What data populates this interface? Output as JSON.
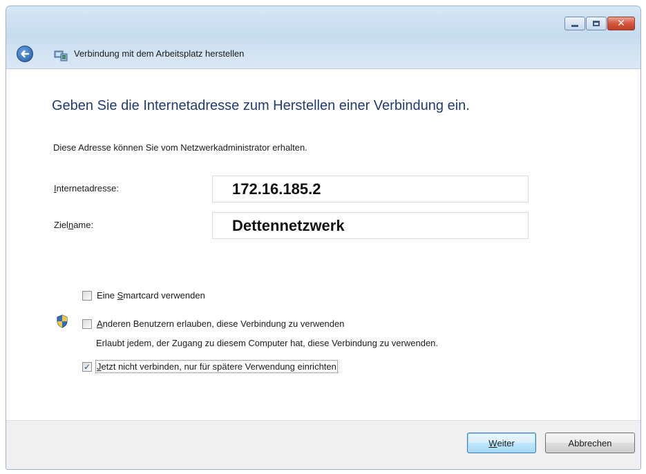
{
  "window": {
    "title": "Verbindung mit dem Arbeitsplatz herstellen",
    "caption_buttons": {
      "minimize": "minimize-icon",
      "maximize": "maximize-icon",
      "close": "close-icon"
    }
  },
  "main": {
    "heading": "Geben Sie die Internetadresse zum Herstellen einer Verbindung ein.",
    "description": "Diese Adresse können Sie vom Netzwerkadministrator erhalten.",
    "fields": [
      {
        "label_prefix": "",
        "label_accel": "I",
        "label_rest": "nternetadresse:",
        "value": "172.16.185.2"
      },
      {
        "label_prefix": "Ziel",
        "label_accel": "n",
        "label_rest": "ame:",
        "value": "Dettennetzwerk"
      }
    ],
    "options": {
      "smartcard": {
        "prefix": "Eine ",
        "accel": "S",
        "rest": "martcard verwenden",
        "checked": false
      },
      "allow_others": {
        "prefix": "",
        "accel": "A",
        "rest": "nderen Benutzern erlauben, diese Verbindung zu verwenden",
        "checked": false,
        "sublabel": "Erlaubt jedem, der Zugang zu diesem Computer hat, diese Verbindung zu verwenden."
      },
      "connect_later": {
        "prefix": "",
        "accel": "J",
        "rest": "etzt nicht verbinden, nur für spätere Verwendung einrichten",
        "checked": true
      }
    }
  },
  "footer": {
    "next_button": {
      "accel": "W",
      "rest": "eiter"
    },
    "cancel_button": "Abbrechen"
  },
  "colors": {
    "heading": "#1f3b73",
    "title_bar": "#c7dcef",
    "footer": "#f0f0f0"
  }
}
